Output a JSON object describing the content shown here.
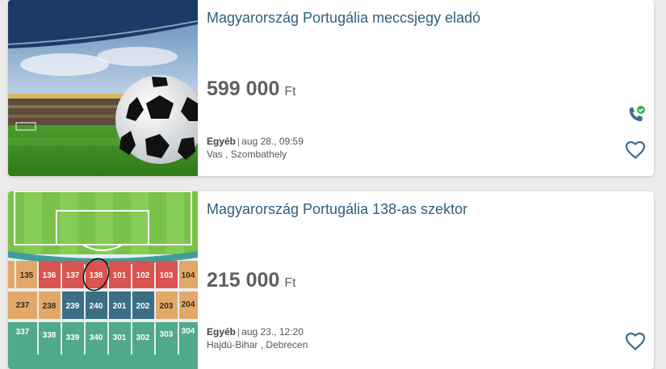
{
  "listings": [
    {
      "title": "Magyarország Portugália meccsjegy eladó",
      "price": "599 000",
      "currency": "Ft",
      "category": "Egyéb",
      "date": "aug 28., 09:59",
      "location": "Vas , Szombathely",
      "image_icon": "stadium-football-photo",
      "has_phone": true
    },
    {
      "title": "Magyarország Portugália 138-as szektor",
      "price": "215 000",
      "currency": "Ft",
      "category": "Egyéb",
      "date": "aug 23., 12:20",
      "location": "Hajdú-Bihar , Debrecen",
      "image_icon": "stadium-seat-map",
      "has_phone": false,
      "seat_map": {
        "row1": [
          "135",
          "136",
          "137",
          "138",
          "101",
          "102",
          "103",
          "104"
        ],
        "row2": [
          "237",
          "238",
          "239",
          "240",
          "201",
          "202",
          "203",
          "204"
        ],
        "row3": [
          "337",
          "338",
          "339",
          "340",
          "301",
          "302",
          "303",
          "304"
        ]
      }
    }
  ],
  "colors": {
    "title": "#2f5f7c",
    "price": "#606060",
    "icon": "#3b6d8c",
    "phone_badge": "#2eb84a"
  }
}
